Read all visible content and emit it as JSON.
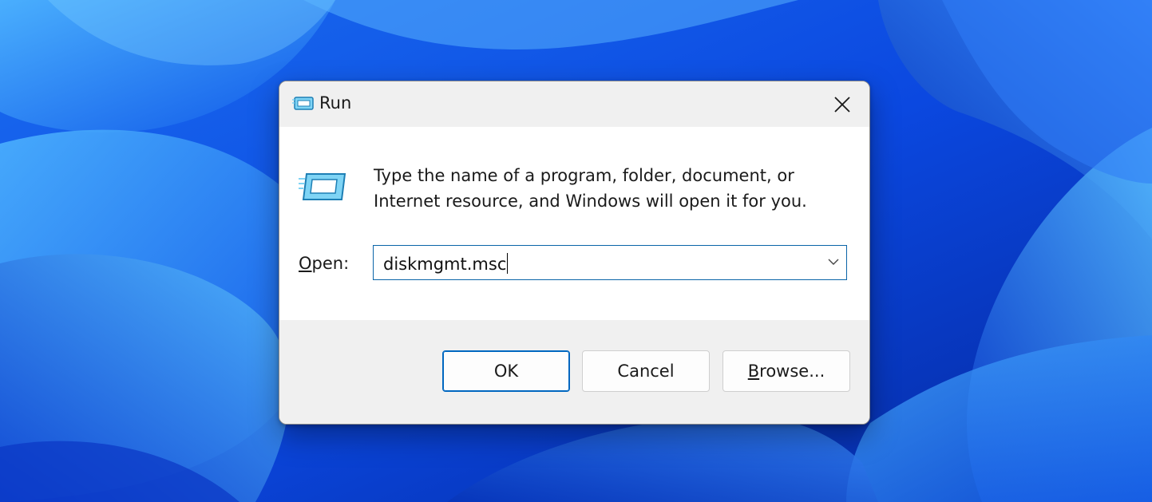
{
  "window": {
    "title": "Run"
  },
  "dialog": {
    "description_line1": "Type the name of a program, folder, document, or",
    "description_line2": "Internet resource, and Windows will open it for you.",
    "open_label_mnemonic": "O",
    "open_label_rest": "pen:",
    "open_value": "diskmgmt.msc"
  },
  "buttons": {
    "ok": "OK",
    "cancel": "Cancel",
    "browse_mnemonic": "B",
    "browse_rest": "rowse..."
  },
  "icons": {
    "title_icon": "run-app-icon",
    "body_icon": "run-app-icon",
    "close": "close-icon",
    "dropdown": "chevron-down-icon"
  },
  "colors": {
    "wallpaper_primary": "#0a3fd6",
    "wallpaper_light": "#4db0ff",
    "accent": "#0067c0",
    "titlebar": "#f0f0f0"
  }
}
